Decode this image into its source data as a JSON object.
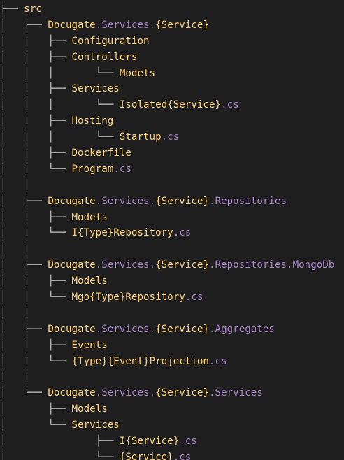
{
  "colors": {
    "background": "#1e1e1e",
    "tree_lines": "#cfcfcf",
    "name": "#ffd175",
    "extension": "#a983c9"
  },
  "lines": [
    {
      "prefix": "├── ",
      "segments": [
        {
          "text": "src",
          "color": "#ffd175"
        }
      ]
    },
    {
      "prefix": "│   ├── ",
      "segments": [
        {
          "text": "Docugate",
          "color": "#ffd175"
        },
        {
          "text": ".Services.",
          "color": "#a983c9"
        },
        {
          "text": "{Service}",
          "color": "#ffd175"
        }
      ]
    },
    {
      "prefix": "│   │   ├── ",
      "segments": [
        {
          "text": "Configuration",
          "color": "#ffd175"
        }
      ]
    },
    {
      "prefix": "│   │   ├── ",
      "segments": [
        {
          "text": "Controllers",
          "color": "#ffd175"
        }
      ]
    },
    {
      "prefix": "│   │   │       └── ",
      "segments": [
        {
          "text": "Models",
          "color": "#ffd175"
        }
      ]
    },
    {
      "prefix": "│   │   ├── ",
      "segments": [
        {
          "text": "Services",
          "color": "#ffd175"
        }
      ]
    },
    {
      "prefix": "│   │   │       └── ",
      "segments": [
        {
          "text": "Isolated{Service}",
          "color": "#ffd175"
        },
        {
          "text": ".cs",
          "color": "#a983c9"
        }
      ]
    },
    {
      "prefix": "│   │   ├── ",
      "segments": [
        {
          "text": "Hosting",
          "color": "#ffd175"
        }
      ]
    },
    {
      "prefix": "│   │   │       └── ",
      "segments": [
        {
          "text": "Startup",
          "color": "#ffd175"
        },
        {
          "text": ".cs",
          "color": "#a983c9"
        }
      ]
    },
    {
      "prefix": "│   │   ├── ",
      "segments": [
        {
          "text": "Dockerfile",
          "color": "#ffd175"
        }
      ]
    },
    {
      "prefix": "│   │   └── ",
      "segments": [
        {
          "text": "Program",
          "color": "#ffd175"
        },
        {
          "text": ".cs",
          "color": "#a983c9"
        }
      ]
    },
    {
      "prefix": "│   │",
      "segments": []
    },
    {
      "prefix": "│   ├── ",
      "segments": [
        {
          "text": "Docugate",
          "color": "#ffd175"
        },
        {
          "text": ".Services.",
          "color": "#a983c9"
        },
        {
          "text": "{Service}",
          "color": "#ffd175"
        },
        {
          "text": ".Repositories",
          "color": "#a983c9"
        }
      ]
    },
    {
      "prefix": "│   │   ├── ",
      "segments": [
        {
          "text": "Models",
          "color": "#ffd175"
        }
      ]
    },
    {
      "prefix": "│   │   └── ",
      "segments": [
        {
          "text": "I{Type}Repository",
          "color": "#ffd175"
        },
        {
          "text": ".cs",
          "color": "#a983c9"
        }
      ]
    },
    {
      "prefix": "│   │",
      "segments": []
    },
    {
      "prefix": "│   ├── ",
      "segments": [
        {
          "text": "Docugate",
          "color": "#ffd175"
        },
        {
          "text": ".Services.",
          "color": "#a983c9"
        },
        {
          "text": "{Service}",
          "color": "#ffd175"
        },
        {
          "text": ".Repositories.MongoDb",
          "color": "#a983c9"
        }
      ]
    },
    {
      "prefix": "│   │   ├── ",
      "segments": [
        {
          "text": "Models",
          "color": "#ffd175"
        }
      ]
    },
    {
      "prefix": "│   │   └── ",
      "segments": [
        {
          "text": "Mgo{Type}Repository",
          "color": "#ffd175"
        },
        {
          "text": ".cs",
          "color": "#a983c9"
        }
      ]
    },
    {
      "prefix": "│   │",
      "segments": []
    },
    {
      "prefix": "│   ├── ",
      "segments": [
        {
          "text": "Docugate",
          "color": "#ffd175"
        },
        {
          "text": ".Services.",
          "color": "#a983c9"
        },
        {
          "text": "{Service}",
          "color": "#ffd175"
        },
        {
          "text": ".Aggregates",
          "color": "#a983c9"
        }
      ]
    },
    {
      "prefix": "│   │   ├── ",
      "segments": [
        {
          "text": "Events",
          "color": "#ffd175"
        }
      ]
    },
    {
      "prefix": "│   │   └── ",
      "segments": [
        {
          "text": "{Type}{Event}Projection",
          "color": "#ffd175"
        },
        {
          "text": ".cs",
          "color": "#a983c9"
        }
      ]
    },
    {
      "prefix": "│   │",
      "segments": []
    },
    {
      "prefix": "│   └── ",
      "segments": [
        {
          "text": "Docugate",
          "color": "#ffd175"
        },
        {
          "text": ".Services.",
          "color": "#a983c9"
        },
        {
          "text": "{Service}",
          "color": "#ffd175"
        },
        {
          "text": ".Services",
          "color": "#a983c9"
        }
      ]
    },
    {
      "prefix": "│       ├── ",
      "segments": [
        {
          "text": "Models",
          "color": "#ffd175"
        }
      ]
    },
    {
      "prefix": "│       └── ",
      "segments": [
        {
          "text": "Services",
          "color": "#ffd175"
        }
      ]
    },
    {
      "prefix": "│               ├── ",
      "segments": [
        {
          "text": "I{Service}",
          "color": "#ffd175"
        },
        {
          "text": ".cs",
          "color": "#a983c9"
        }
      ]
    },
    {
      "prefix": "│               └── ",
      "segments": [
        {
          "text": "{Service}",
          "color": "#ffd175"
        },
        {
          "text": ".cs",
          "color": "#a983c9"
        }
      ]
    }
  ]
}
